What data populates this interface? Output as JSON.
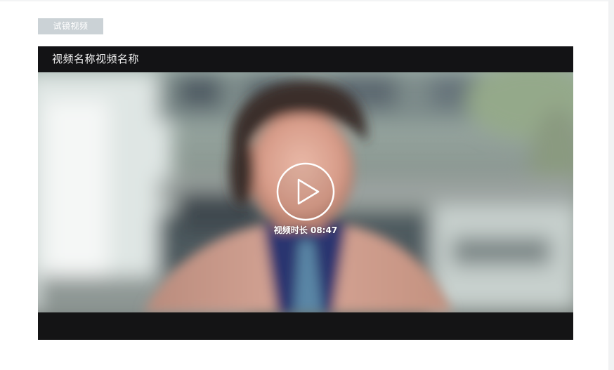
{
  "tag": {
    "label": "试镜视频"
  },
  "player": {
    "title": "视频名称视频名称",
    "duration_label": "视频时长",
    "duration_value": "08:47",
    "duration_text": "视频时长 08:47",
    "play_icon": "play-circle-icon"
  },
  "colors": {
    "tag_background": "#cbd2d6",
    "player_background": "#141414",
    "play_icon": "#ffffff"
  }
}
